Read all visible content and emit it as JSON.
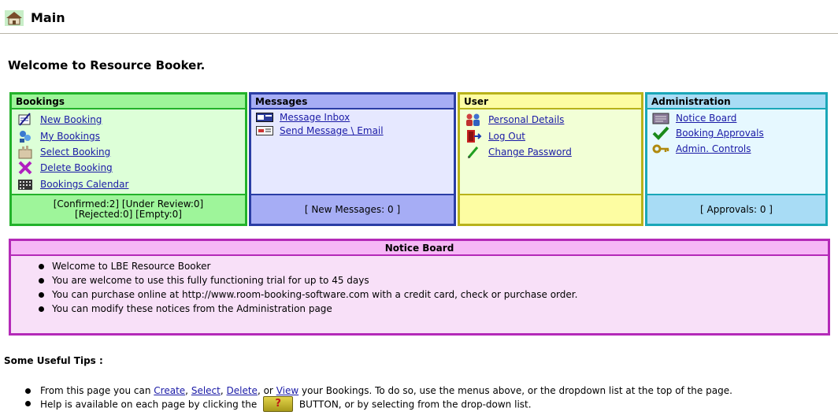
{
  "header": {
    "title": "Main",
    "icon": "home-icon"
  },
  "welcome": "Welcome to Resource Booker.",
  "bookings": {
    "title": "Bookings",
    "items": [
      {
        "label": "New Booking",
        "icon": "new-booking-icon"
      },
      {
        "label": "My Bookings",
        "icon": "my-bookings-icon"
      },
      {
        "label": "Select Booking",
        "icon": "select-booking-icon"
      },
      {
        "label": "Delete Booking",
        "icon": "delete-booking-icon"
      },
      {
        "label": "Bookings Calendar",
        "icon": "calendar-icon"
      }
    ],
    "footer_line1": "[Confirmed:2] [Under Review:0]",
    "footer_line2": "[Rejected:0] [Empty:0]"
  },
  "messages": {
    "title": "Messages",
    "items": [
      {
        "label": "Message Inbox",
        "icon": "inbox-icon"
      },
      {
        "label": "Send Message \\ Email",
        "icon": "send-email-icon"
      }
    ],
    "footer": "[ New Messages: 0 ]"
  },
  "user": {
    "title": "User",
    "items": [
      {
        "label": "Personal Details",
        "icon": "users-icon"
      },
      {
        "label": "Log Out",
        "icon": "logout-icon"
      },
      {
        "label": "Change Password",
        "icon": "pencil-icon"
      }
    ],
    "footer": ""
  },
  "admin": {
    "title": "Administration",
    "items": [
      {
        "label": "Notice Board",
        "icon": "notice-board-icon"
      },
      {
        "label": "Booking Approvals",
        "icon": "checkmark-icon"
      },
      {
        "label": "Admin. Controls",
        "icon": "key-icon"
      }
    ],
    "footer": "[ Approvals: 0 ]"
  },
  "notice": {
    "title": "Notice Board",
    "items": [
      "Welcome to LBE Resource Booker",
      "You are welcome to use this fully functioning trial for up to 45 days",
      "You can purchase online at http://www.room-booking-software.com with a credit card, check or purchase order.",
      "You can modify these notices from the Administration page"
    ]
  },
  "tips": {
    "title": "Some Useful Tips :",
    "line1_prefix": "From this page you can",
    "link_create": "Create",
    "link_select": "Select",
    "link_delete": "Delete",
    "sep1": ",",
    "sep2": ",",
    "sep3": ", or",
    "link_view": "View",
    "line1_suffix": "your Bookings. To do so, use the menus above, or the dropdown list at the top of the page.",
    "line2_prefix": "Help is available on each page by clicking the",
    "help_button_label": "?",
    "line2_suffix": "BUTTON, or by selecting from the drop-down list."
  }
}
